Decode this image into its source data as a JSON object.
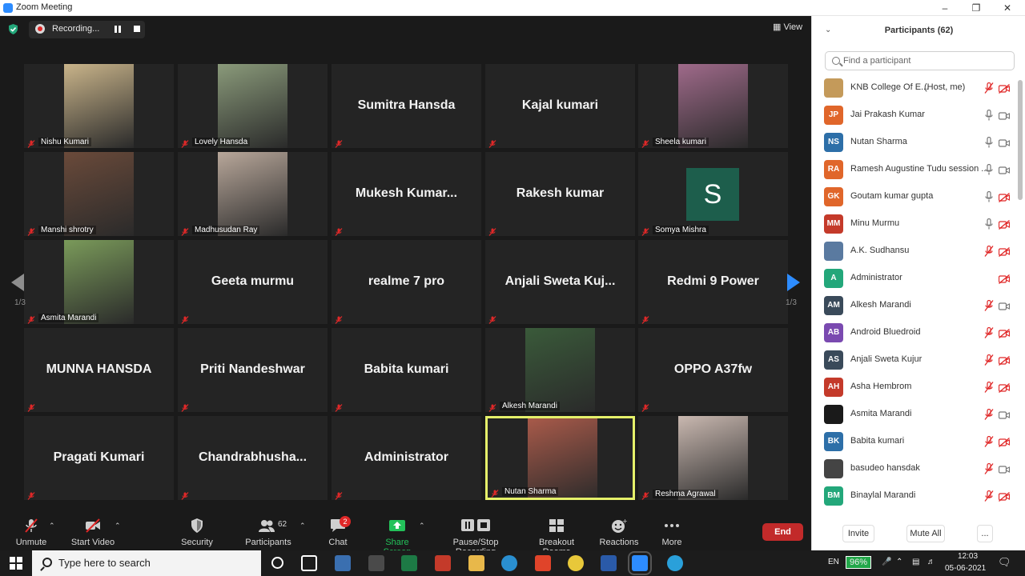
{
  "window": {
    "title": "Zoom Meeting",
    "minimize_icon": "minimize-icon",
    "maximize_icon": "maximize-icon",
    "close_icon": "close-icon"
  },
  "recording": {
    "label": "Recording..."
  },
  "view_button": "View",
  "pager": {
    "left": "1/3",
    "right": "1/3"
  },
  "tiles": [
    {
      "name": "Nishu Kumari",
      "video": true,
      "color": "#c9b48a"
    },
    {
      "name": "Lovely Hansda",
      "video": true,
      "color": "#8a9a7a"
    },
    {
      "name": "Sumitra Hansda",
      "video": false
    },
    {
      "name": "Kajal kumari",
      "video": false
    },
    {
      "name": "Sheela kumari",
      "video": true,
      "color": "#9f6a8a"
    },
    {
      "name": "Manshi shrotry",
      "video": true,
      "color": "#6a4a3a"
    },
    {
      "name": "Madhusudan Ray",
      "video": true,
      "color": "#b8a79a"
    },
    {
      "name": "Mukesh  Kumar...",
      "video": false
    },
    {
      "name": "Rakesh kumar",
      "video": false
    },
    {
      "name": "Somya Mishra",
      "video": false,
      "letter": "S"
    },
    {
      "name": "Asmita Marandi",
      "video": true,
      "color": "#7a9a5a"
    },
    {
      "name": "Geeta murmu",
      "video": false
    },
    {
      "name": "realme 7 pro",
      "video": false
    },
    {
      "name": "Anjali  Sweta  Kuj...",
      "video": false
    },
    {
      "name": "Redmi 9 Power",
      "video": false
    },
    {
      "name": "MUNNA HANSDA",
      "video": false
    },
    {
      "name": "Priti Nandeshwar",
      "video": false
    },
    {
      "name": "Babita kumari",
      "video": false
    },
    {
      "name": "Alkesh Marandi",
      "video": true,
      "color": "#3a5a3a"
    },
    {
      "name": "OPPO A37fw",
      "video": false
    },
    {
      "name": "Pragati Kumari",
      "video": false
    },
    {
      "name": "Chandrabhusha...",
      "video": false
    },
    {
      "name": "Administrator",
      "video": false
    },
    {
      "name": "Nutan Sharma",
      "video": true,
      "color": "#a85a4a",
      "active": true
    },
    {
      "name": "Reshma Agrawal",
      "video": true,
      "color": "#c9b8b0"
    }
  ],
  "toolbar": {
    "unmute": "Unmute",
    "start_video": "Start Video",
    "security": "Security",
    "participants": "Participants",
    "participants_count": "62",
    "chat": "Chat",
    "chat_badge": "2",
    "share_screen": "Share Screen",
    "recording": "Pause/Stop Recording",
    "breakout": "Breakout Rooms",
    "reactions": "Reactions",
    "more": "More",
    "end": "End"
  },
  "panel": {
    "title": "Participants (62)",
    "search_placeholder": "Find a participant",
    "participants": [
      {
        "name": "KNB College Of E...",
        "note": "(Host, me)",
        "initials": "",
        "color": "#c49a5a",
        "mic": "muted",
        "cam": "off"
      },
      {
        "name": "Jai Prakash Kumar",
        "initials": "JP",
        "color": "#e0662a",
        "mic": "on",
        "cam": "on"
      },
      {
        "name": "Nutan Sharma",
        "initials": "NS",
        "color": "#2d6fa8",
        "mic": "on",
        "cam": "on"
      },
      {
        "name": "Ramesh Augustine Tudu session ...",
        "initials": "RA",
        "color": "#e0662a",
        "mic": "on",
        "cam": "on"
      },
      {
        "name": "Goutam kumar gupta",
        "initials": "GK",
        "color": "#e0662a",
        "mic": "on",
        "cam": "off"
      },
      {
        "name": "Minu Murmu",
        "initials": "MM",
        "color": "#c43a2a",
        "mic": "on",
        "cam": "off"
      },
      {
        "name": "A.K. Sudhansu",
        "initials": "",
        "color": "#5a7aa0",
        "mic": "muted",
        "cam": "off"
      },
      {
        "name": "Administrator",
        "initials": "A",
        "color": "#23a77a",
        "mic": "",
        "cam": "off"
      },
      {
        "name": "Alkesh Marandi",
        "initials": "AM",
        "color": "#3a4a5a",
        "mic": "muted",
        "cam": "on"
      },
      {
        "name": "Android Bluedroid",
        "initials": "AB",
        "color": "#7a4ab0",
        "mic": "muted",
        "cam": "off"
      },
      {
        "name": "Anjali Sweta Kujur",
        "initials": "AS",
        "color": "#3a4a5a",
        "mic": "muted",
        "cam": "off"
      },
      {
        "name": "Asha Hembrom",
        "initials": "AH",
        "color": "#c43a2a",
        "mic": "muted",
        "cam": "off"
      },
      {
        "name": "Asmita Marandi",
        "initials": "",
        "color": "#1a1a1a",
        "mic": "muted",
        "cam": "on"
      },
      {
        "name": "Babita kumari",
        "initials": "BK",
        "color": "#2d6fa8",
        "mic": "muted",
        "cam": "off"
      },
      {
        "name": "basudeo hansdak",
        "initials": "",
        "color": "#444444",
        "mic": "muted",
        "cam": "on"
      },
      {
        "name": "Binaylal Marandi",
        "initials": "BM",
        "color": "#23a77a",
        "mic": "muted",
        "cam": "off"
      }
    ],
    "invite": "Invite",
    "mute_all": "Mute All",
    "more": "..."
  },
  "taskbar": {
    "search_placeholder": "Type here to search",
    "lang": "EN",
    "battery": "96%",
    "time": "12:03",
    "date": "05-06-2021"
  }
}
